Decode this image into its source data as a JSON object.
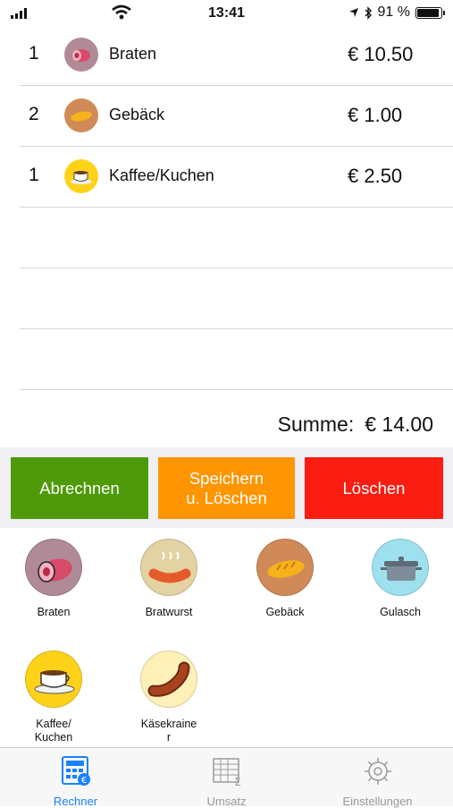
{
  "status": {
    "time": "13:41",
    "battery": "91 %"
  },
  "orders": [
    {
      "qty": "1",
      "name": "Braten",
      "price": "€ 10.50",
      "icon": "roast-icon",
      "color": "#b08a96"
    },
    {
      "qty": "2",
      "name": "Gebäck",
      "price": "€ 1.00",
      "icon": "bread-icon",
      "color": "#d08a58"
    },
    {
      "qty": "1",
      "name": "Kaffee/Kuchen",
      "price": "€ 2.50",
      "icon": "coffee-icon",
      "color": "#ffd21a"
    }
  ],
  "total": {
    "label": "Summe:",
    "value": "€ 14.00"
  },
  "actions": {
    "checkout": "Abrechnen",
    "save_line1": "Speichern",
    "save_line2": "u. Löschen",
    "delete": "Löschen"
  },
  "products": [
    {
      "label": "Braten",
      "icon": "roast-icon",
      "color": "#b08a96"
    },
    {
      "label": "Bratwurst",
      "icon": "sausage-icon",
      "color": "#e3d3a3"
    },
    {
      "label": "Gebäck",
      "icon": "bread-icon",
      "color": "#d08a58"
    },
    {
      "label": "Gulasch",
      "icon": "pot-icon",
      "color": "#9fe0ef"
    },
    {
      "label": "Kaffee/\nKuchen",
      "icon": "coffee-icon",
      "color": "#ffd21a"
    },
    {
      "label": "Käsekraine\nr",
      "icon": "cheese-sausage-icon",
      "color": "#fff0b8"
    }
  ],
  "tabs": [
    {
      "label": "Rechner",
      "active": true
    },
    {
      "label": "Umsatz",
      "active": false
    },
    {
      "label": "Einstellungen",
      "active": false
    }
  ],
  "colors": {
    "accent": "#1a82fb",
    "tab_inactive": "#9a9a9a"
  }
}
